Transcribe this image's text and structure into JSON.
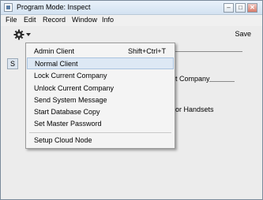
{
  "window": {
    "title": "Program Mode: Inspect",
    "min_glyph": "–",
    "max_glyph": "□",
    "close_glyph": "✕"
  },
  "menubar": {
    "items": [
      "File",
      "Edit",
      "Record",
      "Window",
      "Info"
    ]
  },
  "toolbar": {
    "save_label": "Save"
  },
  "background": {
    "tab_label": "S",
    "company_label": "t Company",
    "handsets_label": "or Handsets"
  },
  "dropdown": {
    "items": [
      {
        "label": "Admin Client",
        "shortcut": "Shift+Ctrl+T"
      },
      {
        "label": "Normal Client",
        "highlighted": true
      },
      {
        "label": "Lock Current Company"
      },
      {
        "label": "Unlock Current Company"
      },
      {
        "label": "Send System Message"
      },
      {
        "label": "Start Database Copy"
      },
      {
        "label": "Set Master Password"
      },
      {
        "label": "Setup Cloud Node"
      }
    ]
  },
  "colors": {
    "highlight": "#dde8f4",
    "titlebar": "#d3e2f1"
  }
}
